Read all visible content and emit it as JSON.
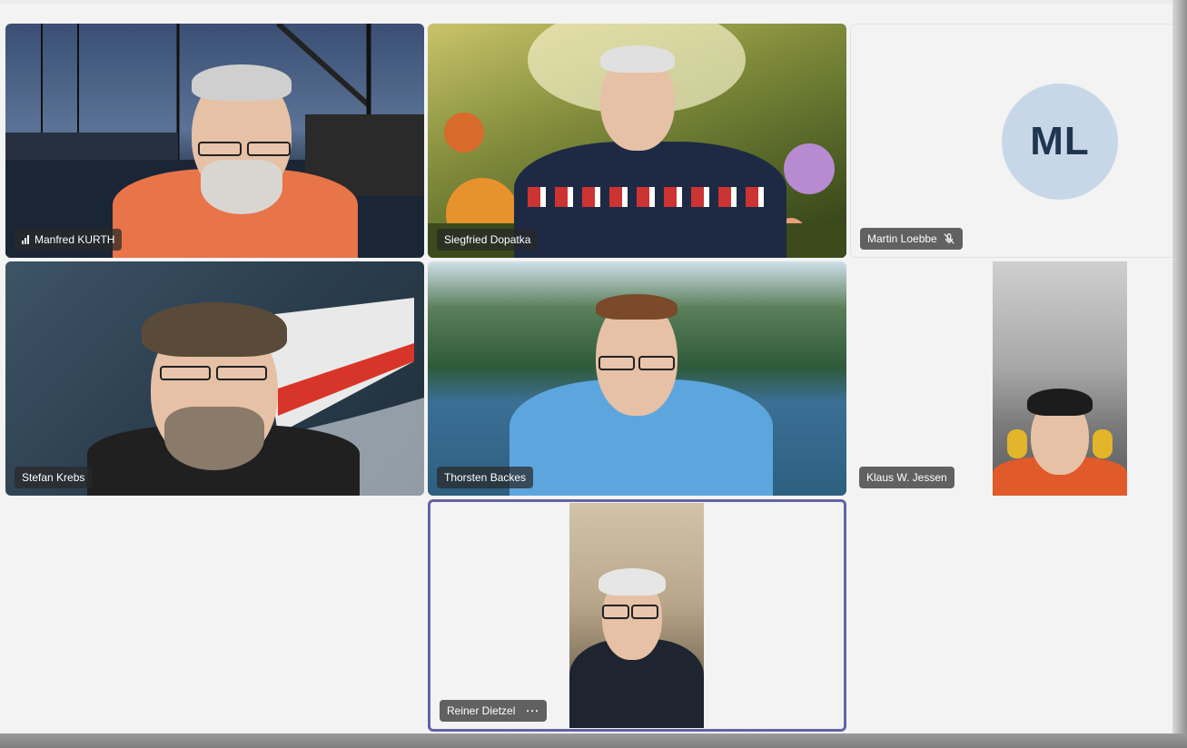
{
  "participants": [
    {
      "name": "Manfred KURTH",
      "indicator": "signal-bars-icon"
    },
    {
      "name": "Siegfried Dopatka"
    },
    {
      "name": "Martin Loebbe",
      "initials": "ML",
      "indicator": "mic-muted-icon"
    },
    {
      "name": "Stefan Krebs"
    },
    {
      "name": "Thorsten Backes"
    },
    {
      "name": "Klaus W. Jessen"
    },
    {
      "name": "Reiner Dietzel",
      "more": "···",
      "active_speaker": true
    }
  ],
  "colors": {
    "active_border": "#6264a7",
    "avatar_bg": "#c8d7e8",
    "avatar_text": "#1f3550",
    "name_tag_bg": "rgba(40,40,40,0.72)"
  }
}
